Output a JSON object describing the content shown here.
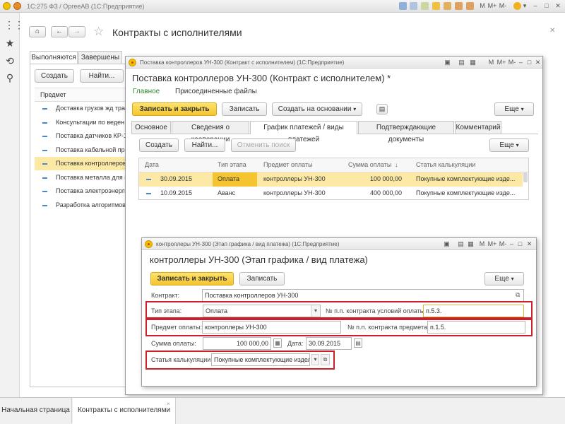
{
  "app_title": "1С:275 ФЗ / ОргееАВ  (1С:Предприятие)",
  "titlebar_buttons": [
    "M",
    "M+",
    "M-"
  ],
  "page": {
    "title": "Контракты с исполнителями",
    "tabs": [
      "Выполняются",
      "Завершены"
    ],
    "create_label": "Создать",
    "find_label": "Найти...",
    "column_header": "Предмет",
    "items": [
      "Доставка грузов жд тра",
      "Консультации по веден",
      "Поставка датчиков КР-1",
      "Поставка кабельной про",
      "Поставка контроллеров",
      "Поставка металла для к",
      "Поставка электроэнерги",
      "Разработка алгоритмов"
    ],
    "selected_index": 4
  },
  "contract_window": {
    "title_bar": "Поставка контроллеров УН-300 (Контракт с исполнителем)  (1С:Предприятие)",
    "heading": "Поставка контроллеров УН-300 (Контракт с исполнителем) *",
    "nav": [
      "Главное",
      "Присоединенные файлы"
    ],
    "buttons": {
      "write_close": "Записать и закрыть",
      "write": "Записать",
      "create_based": "Создать на основании",
      "more": "Еще"
    },
    "tabs": [
      "Основное",
      "Сведения о кооперации",
      "График платежей / виды платежей",
      "Подтверждающие документы",
      "Комментарий"
    ],
    "active_tab": 2,
    "table_buttons": {
      "create": "Создать",
      "find": "Найти...",
      "cancel_search": "Отменить поиск",
      "more": "Еще"
    },
    "table": {
      "headers": [
        "Дата",
        "Тип этапа",
        "Предмет оплаты",
        "Сумма оплаты",
        "Статья калькуляции"
      ],
      "rows": [
        [
          "30.09.2015",
          "Оплата",
          "контроллеры УН-300",
          "100 000,00",
          "Покупные комплектующие изде..."
        ],
        [
          "10.09.2015",
          "Аванс",
          "контроллеры УН-300",
          "400 000,00",
          "Покупные комплектующие изде..."
        ]
      ]
    }
  },
  "stage_window": {
    "title_bar": "контроллеры УН-300 (Этап графика / вид платежа)  (1С:Предприятие)",
    "heading": "контроллеры УН-300 (Этап графика / вид платежа)",
    "buttons": {
      "write_close": "Записать и закрыть",
      "write": "Записать",
      "more": "Еще"
    },
    "fields": {
      "contract_label": "Контракт:",
      "contract_value": "Поставка контроллеров УН-300",
      "stage_type_label": "Тип этапа:",
      "stage_type_value": "Оплата",
      "contract_terms_no_label": "№ п.п. контракта условий оплаты:",
      "contract_terms_no_value": "п.5.3.",
      "subject_label": "Предмет оплаты:",
      "subject_value": "контроллеры УН-300",
      "subject_no_label": "№ п.п. контракта предмета:",
      "subject_no_value": "п.1.5.",
      "amount_label": "Сумма оплаты:",
      "amount_value": "100 000,00",
      "date_label": "Дата:",
      "date_value": "30.09.2015",
      "calc_item_label": "Статья калькуляции:",
      "calc_item_value": "Покупные комплектующие издел"
    }
  },
  "bottom_tabs": [
    "Начальная страница",
    "Контракты с исполнителями"
  ]
}
